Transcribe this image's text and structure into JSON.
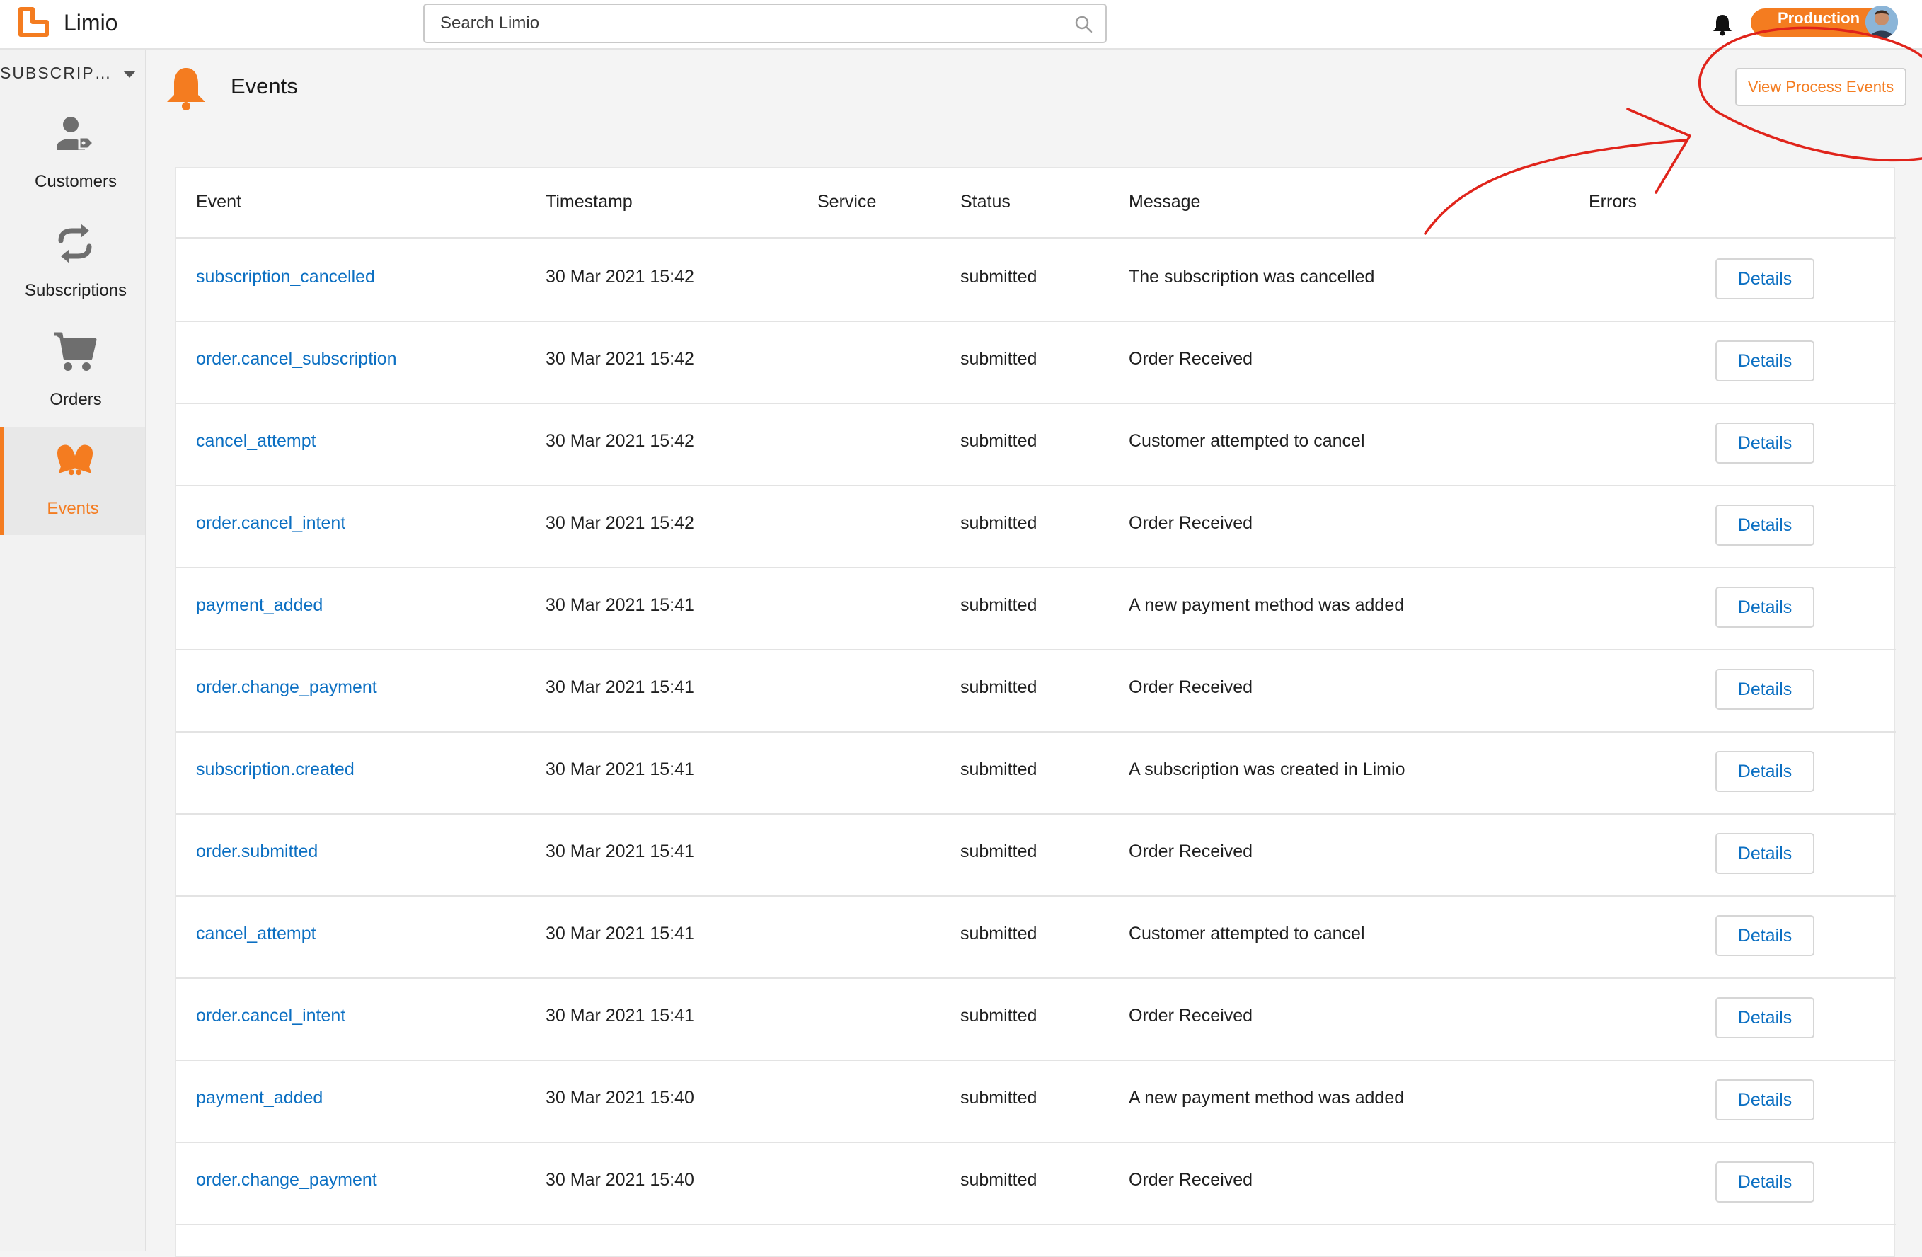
{
  "app": {
    "brand": "Limio"
  },
  "header": {
    "search_placeholder": "Search Limio",
    "environment_badge": "Production",
    "colors": {
      "accent": "#f47c20",
      "link": "#0b6fc2"
    }
  },
  "sidebar": {
    "app_selector": "SUBSCRIPTI...",
    "items": [
      {
        "label": "Customers",
        "icon": "customers-icon"
      },
      {
        "label": "Subscriptions",
        "icon": "subscriptions-icon"
      },
      {
        "label": "Orders",
        "icon": "cart-icon"
      },
      {
        "label": "Events",
        "icon": "bell-icon",
        "active": true
      }
    ]
  },
  "page": {
    "title": "Events",
    "process_button": "View Process Events"
  },
  "table": {
    "columns": [
      "Event",
      "Timestamp",
      "Service",
      "Status",
      "Message",
      "Errors"
    ],
    "details_label": "Details",
    "rows": [
      {
        "event": "subscription_cancelled",
        "timestamp": "30 Mar 2021 15:42",
        "service": "",
        "status": "submitted",
        "message": "The subscription was cancelled",
        "errors": ""
      },
      {
        "event": "order.cancel_subscription",
        "timestamp": "30 Mar 2021 15:42",
        "service": "",
        "status": "submitted",
        "message": "Order Received",
        "errors": ""
      },
      {
        "event": "cancel_attempt",
        "timestamp": "30 Mar 2021 15:42",
        "service": "",
        "status": "submitted",
        "message": "Customer attempted to cancel",
        "errors": ""
      },
      {
        "event": "order.cancel_intent",
        "timestamp": "30 Mar 2021 15:42",
        "service": "",
        "status": "submitted",
        "message": "Order Received",
        "errors": ""
      },
      {
        "event": "payment_added",
        "timestamp": "30 Mar 2021 15:41",
        "service": "",
        "status": "submitted",
        "message": "A new payment method was added",
        "errors": ""
      },
      {
        "event": "order.change_payment",
        "timestamp": "30 Mar 2021 15:41",
        "service": "",
        "status": "submitted",
        "message": "Order Received",
        "errors": ""
      },
      {
        "event": "subscription.created",
        "timestamp": "30 Mar 2021 15:41",
        "service": "",
        "status": "submitted",
        "message": "A subscription was created in Limio",
        "errors": ""
      },
      {
        "event": "order.submitted",
        "timestamp": "30 Mar 2021 15:41",
        "service": "",
        "status": "submitted",
        "message": "Order Received",
        "errors": ""
      },
      {
        "event": "cancel_attempt",
        "timestamp": "30 Mar 2021 15:41",
        "service": "",
        "status": "submitted",
        "message": "Customer attempted to cancel",
        "errors": ""
      },
      {
        "event": "order.cancel_intent",
        "timestamp": "30 Mar 2021 15:41",
        "service": "",
        "status": "submitted",
        "message": "Order Received",
        "errors": ""
      },
      {
        "event": "payment_added",
        "timestamp": "30 Mar 2021 15:40",
        "service": "",
        "status": "submitted",
        "message": "A new payment method was added",
        "errors": ""
      },
      {
        "event": "order.change_payment",
        "timestamp": "30 Mar 2021 15:40",
        "service": "",
        "status": "submitted",
        "message": "Order Received",
        "errors": ""
      }
    ]
  },
  "annotation": {
    "color": "#e0241b"
  }
}
